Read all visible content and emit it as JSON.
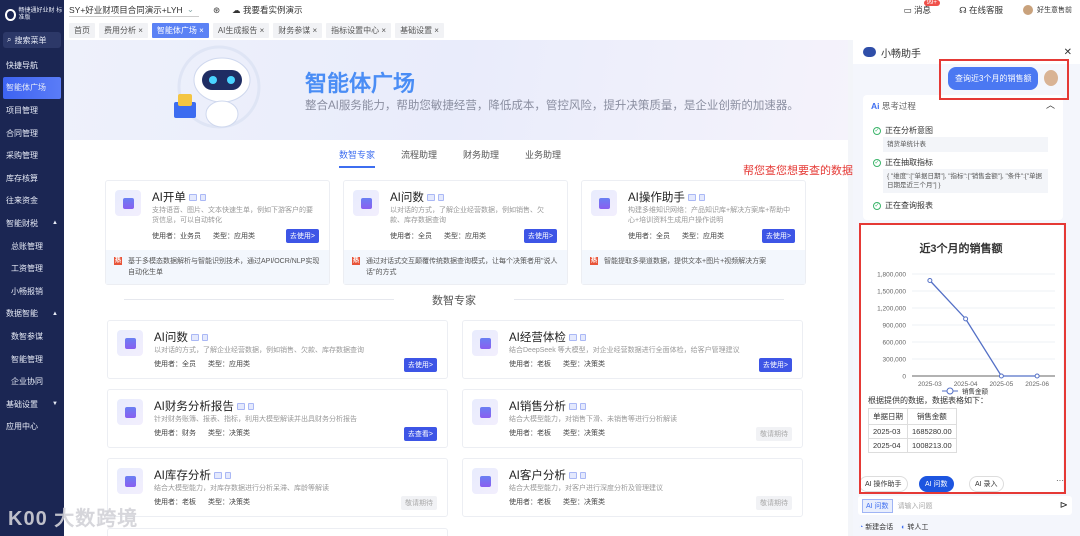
{
  "sidebar": {
    "logo": "畅捷通好业财 标准版",
    "search": "搜索菜单",
    "items": [
      {
        "label": "快捷导航"
      },
      {
        "label": "智能体广场",
        "active": true
      },
      {
        "label": "项目管理"
      },
      {
        "label": "合同管理"
      },
      {
        "label": "采购管理"
      },
      {
        "label": "库存核算"
      },
      {
        "label": "往来资金"
      },
      {
        "label": "智能财税",
        "expand": "▲"
      },
      {
        "label": "总账管理",
        "sub": true
      },
      {
        "label": "工资管理",
        "sub": true
      },
      {
        "label": "小畅报销",
        "sub": true
      },
      {
        "label": "数据智能",
        "expand": "▲"
      },
      {
        "label": "数智参谋",
        "sub": true
      },
      {
        "label": "智能管理",
        "sub": true
      },
      {
        "label": "企业协同",
        "sub": true
      },
      {
        "label": "基础设置",
        "expand": "▼"
      },
      {
        "label": "应用中心"
      }
    ]
  },
  "topbar": {
    "project": "SY+好业财项目合同演示+LYH",
    "demo": "我要看实例演示",
    "messages": "消息",
    "badge": "99+",
    "service": "在线客服",
    "user": "好生意售前"
  },
  "tabs": [
    "首页",
    "费用分析 ×",
    "智能体广场 ×",
    "AI生成报告 ×",
    "财务参谋 ×",
    "指标设置中心 ×",
    "基础设置 ×"
  ],
  "banner": {
    "title": "智能体广场",
    "subtitle": "整合AI服务能力，帮助您敏捷经营，降低成本，管控风险，提升决策质量，是企业创新的加速器。"
  },
  "category_tabs": [
    "数智专家",
    "流程助理",
    "财务助理",
    "业务助理"
  ],
  "featured": [
    {
      "title": "AI开单",
      "desc": "支持语音、图片、文本快速生单，例如下游客户的要货信息，可以自动转化",
      "user": "使用者：业务员",
      "type": "类型：应用类",
      "button": "去使用>",
      "hot": "基于多模态数据解析与智能识别技术，通过API/OCR/NLP实现自动化生单"
    },
    {
      "title": "AI问数",
      "desc": "以对话的方式，了解企业经营数据，例如销售、欠款、库存数据查询",
      "user": "使用者：全员",
      "type": "类型：应用类",
      "button": "去使用>",
      "hot": "通过对话式交互颠覆传统数据查询模式，让每个决策者用\"说人话\"的方式"
    },
    {
      "title": "AI操作助手",
      "desc": "构建多维知识网络：产品知识库+解决方案库+帮助中心+培训资料生成用户操作说明",
      "user": "使用者：全员",
      "type": "类型：应用类",
      "button": "去使用>",
      "hot": "智能提取多渠道数据，提供文本+图片+视频解决方案"
    }
  ],
  "section_title": "数智专家",
  "agents": [
    {
      "title": "AI问数",
      "desc": "以对话的方式，了解企业经营数据，例如销售、欠款、库存数据查询",
      "user": "使用者：全员",
      "type": "类型：应用类",
      "button": "去使用>",
      "enabled": true
    },
    {
      "title": "AI经营体检",
      "desc": "结合DeepSeek 等大模型，对企业经营数据进行全面体检，给客户管理建议",
      "user": "使用者：老板",
      "type": "类型：决策类",
      "button": "去使用>",
      "enabled": true
    },
    {
      "title": "AI财务分析报告",
      "desc": "针对财务账簿、报表、指标，利用大模型解读并出具财务分析报告",
      "user": "使用者：财务",
      "type": "类型：决策类",
      "button": "去查看>",
      "enabled": true
    },
    {
      "title": "AI销售分析",
      "desc": "结合大模型能力，对销售下滑、未销售等进行分析解读",
      "user": "使用者：老板",
      "type": "类型：决策类",
      "button": "敬请期待",
      "enabled": false
    },
    {
      "title": "AI库存分析",
      "desc": "结合大模型能力，对库存数据进行分析呆滞、库龄等解读",
      "user": "使用者：老板",
      "type": "类型：决策类",
      "button": "敬请期待",
      "enabled": false
    },
    {
      "title": "AI客户分析",
      "desc": "结合大模型能力，对客户进行深度分析及管理建议",
      "user": "使用者：老板",
      "type": "类型：决策类",
      "button": "敬请期待",
      "enabled": false
    }
  ],
  "annotation": "帮您查您想要查的数据",
  "assistant": {
    "title": "小畅助手",
    "query": "查询近3个月的销售额",
    "thinking_title": "思考过程",
    "steps": [
      {
        "label": "正在分析意图",
        "detail": "销货单统计表"
      },
      {
        "label": "正在抽取指标",
        "detail": "{ \"维度\":[\"单据日期\"], \"指标\":[\"销售金额\"], \"条件\":[\"单据日期是近三个月\"] }"
      },
      {
        "label": "正在查询报表",
        "detail": ""
      }
    ],
    "result_intro": "根据提供的数据，数据表格如下：",
    "table": {
      "headers": [
        "单据日期",
        "销售金额"
      ],
      "rows": [
        [
          "2025-03",
          "1685280.00"
        ],
        [
          "2025-04",
          "1008213.00"
        ]
      ]
    },
    "chips": [
      "AI 操作助手",
      "AI 问数",
      "AI 录入"
    ],
    "input_tag": "AI 问数",
    "input_placeholder": "请输入问题",
    "footer": [
      "新建会话",
      "转人工"
    ]
  },
  "chart_data": {
    "type": "line",
    "title": "近3个月的销售额",
    "categories": [
      "2025-03",
      "2025-04",
      "2025-05",
      "2025-06"
    ],
    "series": [
      {
        "name": "销售金额",
        "values": [
          1685280,
          1008213,
          0,
          0
        ]
      }
    ],
    "ylim": [
      0,
      1800000
    ],
    "yticks": [
      "0",
      "300,000",
      "600,000",
      "900,000",
      "1,200,000",
      "1,500,000",
      "1,800,000"
    ],
    "legend": "bottom",
    "color": "#5470c6"
  },
  "watermark": "K00 大数跨境"
}
